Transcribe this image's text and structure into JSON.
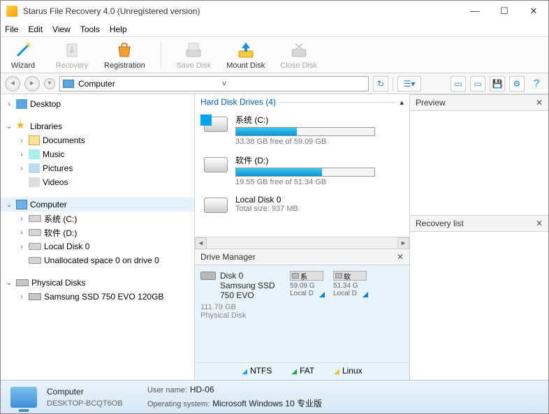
{
  "window": {
    "title": "Starus File Recovery 4.0 (Unregistered version)"
  },
  "menu": {
    "file": "File",
    "edit": "Edit",
    "view": "View",
    "tools": "Tools",
    "help": "Help"
  },
  "toolbar": {
    "wizard": "Wizard",
    "recovery": "Recovery",
    "registration": "Registration",
    "save_disk": "Save Disk",
    "mount_disk": "Mount Disk",
    "close_disk": "Close Disk"
  },
  "address": {
    "text": "Computer"
  },
  "tree": {
    "desktop": "Desktop",
    "libraries": "Libraries",
    "documents": "Documents",
    "music": "Music",
    "pictures": "Pictures",
    "videos": "Videos",
    "computer": "Computer",
    "drive_c": "系统 (C:)",
    "drive_d": "软件 (D:)",
    "local0": "Local Disk 0",
    "unalloc": "Unallocated space 0 on drive 0",
    "physical": "Physical Disks",
    "ssd": "Samsung SSD 750 EVO 120GB"
  },
  "main": {
    "section": "Hard Disk Drives (4)",
    "drives": [
      {
        "name": "系统 (C:)",
        "free": "33.38 GB free of 59.09 GB",
        "fill": 44,
        "win": true
      },
      {
        "name": "软件 (D:)",
        "free": "19.55 GB free of 51.34 GB",
        "fill": 62,
        "win": false
      },
      {
        "name": "Local Disk 0",
        "free": "Total size: 937 MB",
        "fill": 0,
        "win": false,
        "nobar": true
      }
    ]
  },
  "drive_manager": {
    "title": "Drive Manager",
    "disk": {
      "label": "Disk 0",
      "model": "Samsung SSD 750 EVO",
      "size": "111.79 GB",
      "type": "Physical Disk"
    },
    "parts": [
      {
        "short": "系",
        "size": "59.09 G",
        "name": "Local D"
      },
      {
        "short": "软",
        "size": "51.34 G",
        "name": "Local D"
      }
    ],
    "legend": {
      "ntfs": "NTFS",
      "fat": "FAT",
      "linux": "Linux"
    }
  },
  "preview": {
    "title": "Preview"
  },
  "recovery": {
    "title": "Recovery list"
  },
  "status": {
    "name": "Computer",
    "host": "DESKTOP-BCQT6OB",
    "user_k": "User name:",
    "user_v": "HD-06",
    "os_k": "Operating system:",
    "os_v": "Microsoft Windows 10 专业版"
  }
}
